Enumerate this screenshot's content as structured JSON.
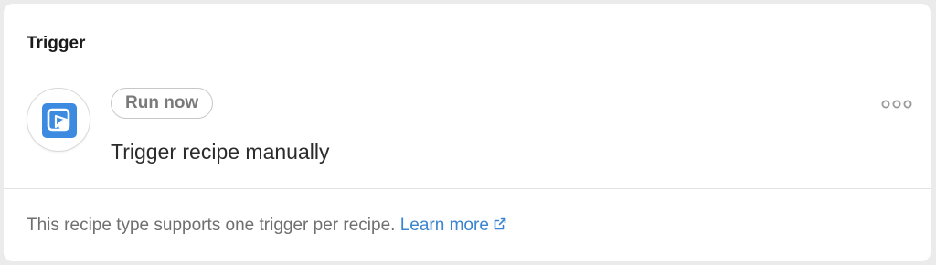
{
  "section": {
    "title": "Trigger"
  },
  "trigger": {
    "badge_label": "Run now",
    "title": "Trigger recipe manually",
    "app_icon": "manual-trigger-icon",
    "menu_icon": "more-options-icon"
  },
  "footer": {
    "text": "This recipe type supports one trigger per recipe.",
    "link_label": "Learn more",
    "link_icon": "external-link-icon"
  },
  "colors": {
    "accent_blue": "#3b84cf",
    "icon_blue": "#3d8be0",
    "badge_border": "#c7c7c7"
  }
}
